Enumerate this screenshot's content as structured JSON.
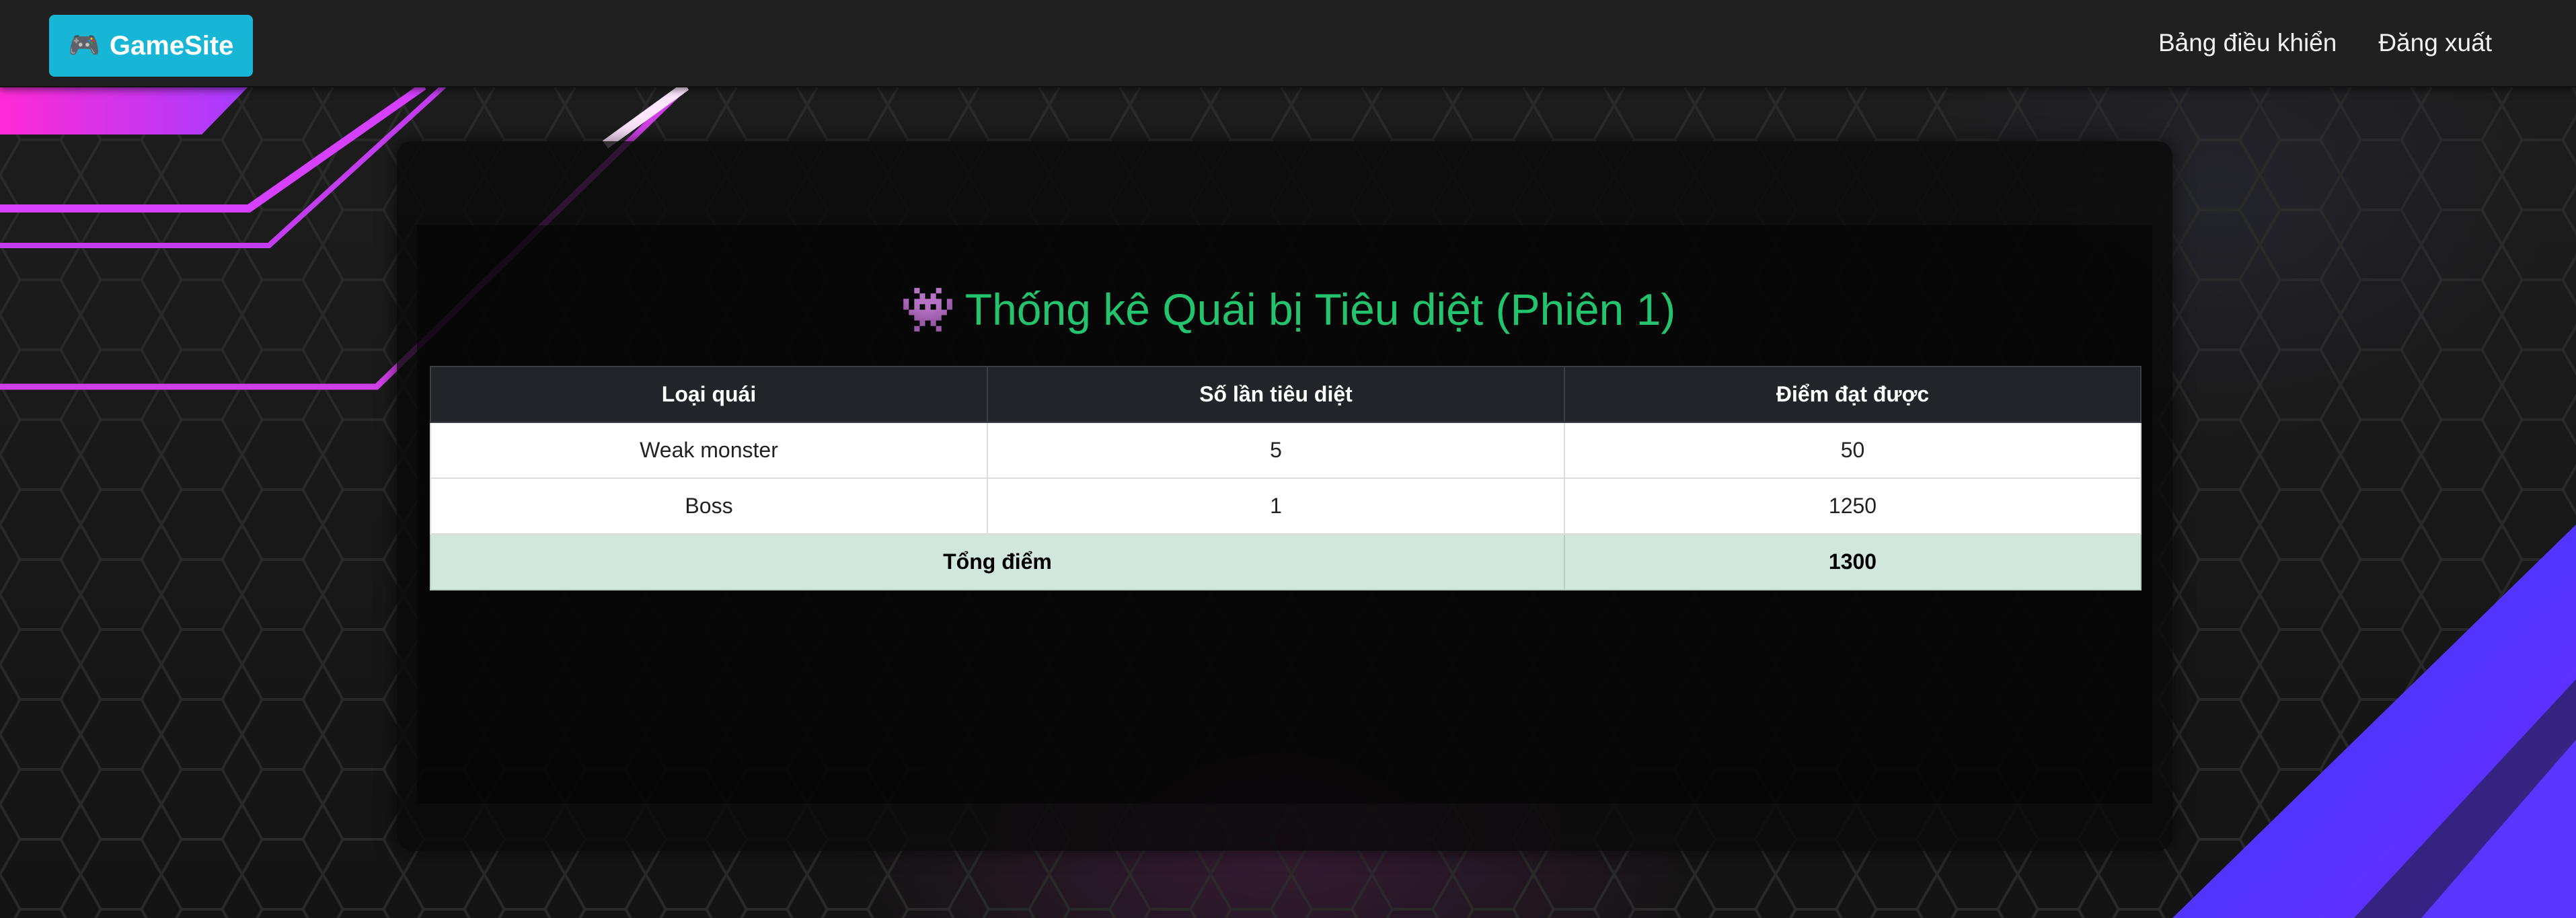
{
  "navbar": {
    "brand_icon": "gamepad-icon",
    "brand_label": "GameSite",
    "brand_color": "#17b6d6",
    "links": [
      {
        "label": "Bảng điều khiển"
      },
      {
        "label": "Đăng xuất"
      }
    ]
  },
  "page": {
    "title_icon": "space-invader-icon",
    "title": "Thống kê Quái bị Tiêu diệt (Phiên 1)",
    "title_color": "#23c46d"
  },
  "table": {
    "headers": [
      "Loại quái",
      "Số lần tiêu diệt",
      "Điểm đạt được"
    ],
    "rows": [
      {
        "type": "Weak monster",
        "kills": "5",
        "points": "50"
      },
      {
        "type": "Boss",
        "kills": "1",
        "points": "1250"
      }
    ],
    "footer": {
      "label": "Tổng điểm",
      "total": "1300"
    }
  }
}
